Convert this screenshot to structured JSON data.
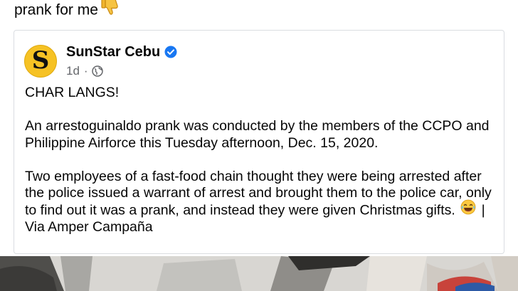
{
  "post": {
    "text": "prank for me",
    "emoji": "thumbs-down-icon"
  },
  "shared_post": {
    "page_name": "SunStar Cebu",
    "verified_icon": "verified-badge-icon",
    "avatar_letter": "S",
    "avatar_color": "#f6c224",
    "time": "1d",
    "separator": "·",
    "audience_icon": "globe-icon",
    "headline": "CHAR LANGS!",
    "paragraph_1": "An arrestoguinaldo prank was conducted by the members of the CCPO and Philippine Airforce this Tuesday afternoon, Dec. 15, 2020.",
    "paragraph_2_text": "Two employees of a fast-food chain thought they were being arrested after the police issued a warrant of arrest and brought them to the police car, only to find out it was a prank, and instead they were given Christmas gifts.",
    "paragraph_2_emoji": "laughing-tears-emoji-icon",
    "paragraph_2_suffix": "| Via Amper Campaña"
  },
  "colors": {
    "text": "#050505",
    "secondary_text": "#65676b",
    "verified_blue": "#1877f2",
    "card_border": "#dadde1"
  }
}
